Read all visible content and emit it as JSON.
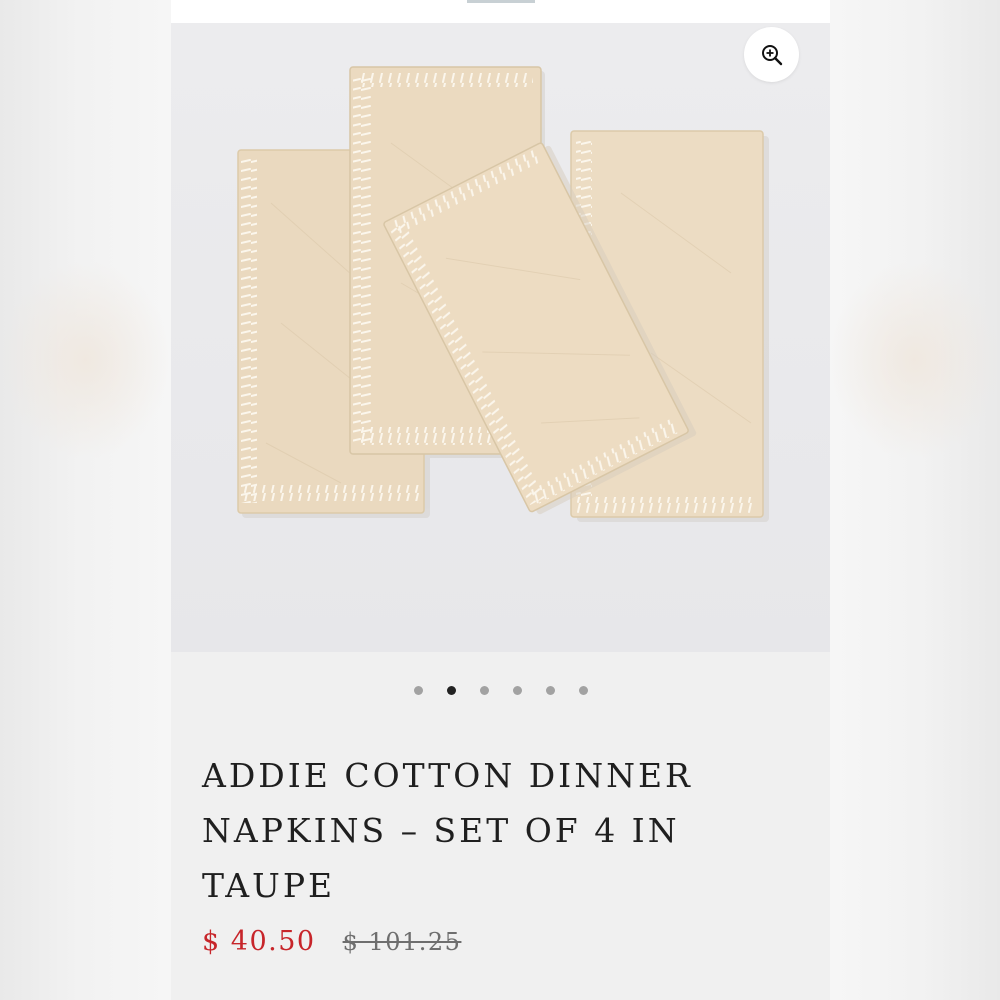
{
  "product": {
    "title": "ADDIE COTTON DINNER NAPKINS – SET OF 4 IN TAUPE",
    "sale_price": "$ 40.50",
    "original_price": "$ 101.25"
  },
  "gallery": {
    "image_count": 6,
    "active_index": 1,
    "zoom_icon": "zoom-in-icon",
    "image_subject": "napkin-product-photo"
  },
  "colors": {
    "sale_price": "#c7252a",
    "title": "#1f1f1f",
    "dot_inactive": "#a2a2a2",
    "dot_active": "#222222",
    "napkin": "#ead9bf"
  }
}
